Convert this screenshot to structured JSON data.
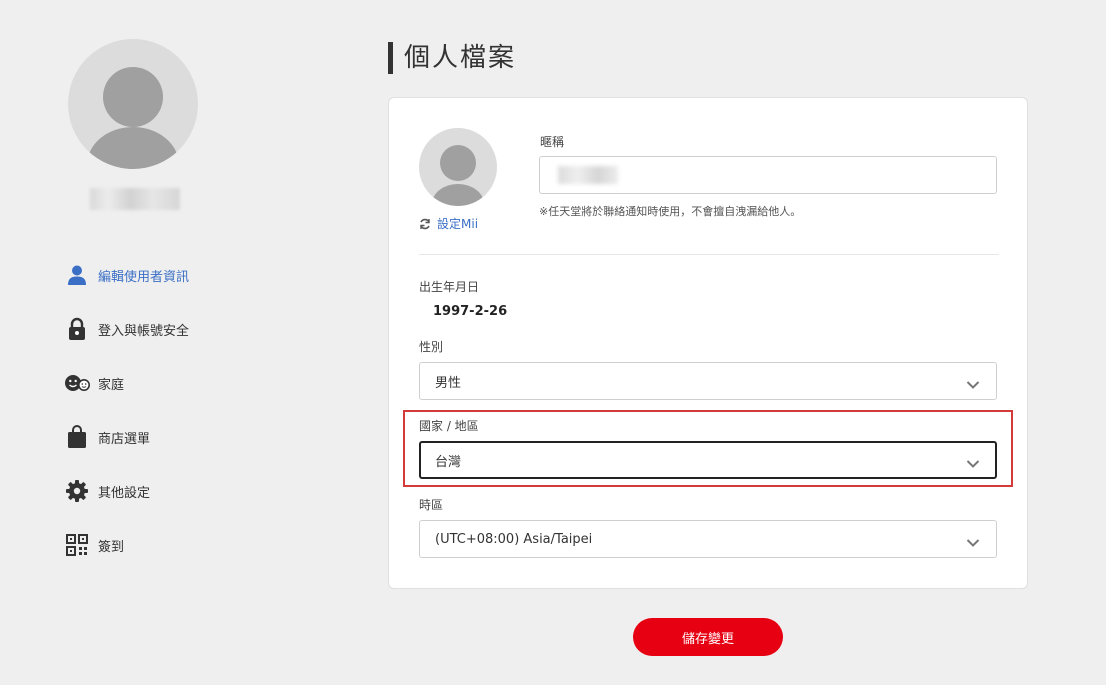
{
  "sidebar": {
    "items": [
      {
        "label": "編輯使用者資訊",
        "icon": "user-icon",
        "active": true
      },
      {
        "label": "登入與帳號安全",
        "icon": "lock-icon",
        "active": false
      },
      {
        "label": "家庭",
        "icon": "family-icon",
        "active": false
      },
      {
        "label": "商店選單",
        "icon": "shopping-bag-icon",
        "active": false
      },
      {
        "label": "其他設定",
        "icon": "gear-icon",
        "active": false
      },
      {
        "label": "簽到",
        "icon": "qr-code-icon",
        "active": false
      }
    ]
  },
  "main": {
    "title": "個人檔案",
    "mii_link": "設定Mii",
    "nickname": {
      "label": "暱稱",
      "note": "※任天堂將於聯絡通知時使用，不會擅自洩漏給他人。"
    },
    "birthdate": {
      "label": "出生年月日",
      "value": "1997-2-26"
    },
    "gender": {
      "label": "性別",
      "value": "男性"
    },
    "country": {
      "label": "國家 / 地區",
      "value": "台灣"
    },
    "timezone": {
      "label": "時區",
      "value": "(UTC+08:00) Asia/Taipei"
    },
    "save_label": "儲存變更"
  },
  "colors": {
    "accent_link": "#3b6fc6",
    "save_button": "#e60012",
    "highlight_box": "#d33a3a"
  }
}
